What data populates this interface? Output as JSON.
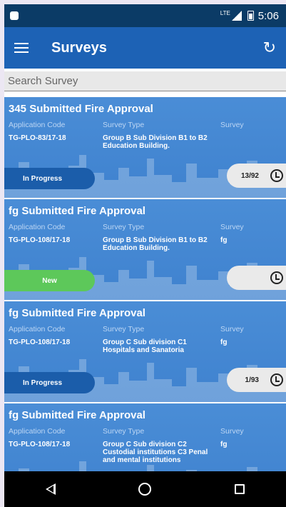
{
  "status_bar": {
    "network": "LTE",
    "time": "5:06"
  },
  "app_bar": {
    "title": "Surveys",
    "menu_icon": "hamburger-icon",
    "refresh_icon": "refresh-icon"
  },
  "search": {
    "placeholder": "Search Survey",
    "value": ""
  },
  "columns": {
    "app_code": "Application Code",
    "survey_type": "Survey Type",
    "survey": "Survey"
  },
  "cards": [
    {
      "title": "345 Submitted Fire Approval",
      "app_code": "TG-PLO-83/17-18",
      "survey_type": "Group B Sub Division B1 to B2 Education Building.",
      "survey": "",
      "status": "In Progress",
      "count": "13/92"
    },
    {
      "title": "fg Submitted Fire Approval",
      "app_code": "TG-PLO-108/17-18",
      "survey_type": "Group B Sub Division B1 to B2 Education Building.",
      "survey": "fg",
      "status": "New",
      "count": ""
    },
    {
      "title": "fg Submitted Fire Approval",
      "app_code": "TG-PLO-108/17-18",
      "survey_type": "Group C Sub division C1 Hospitals and Sanatoria",
      "survey": "fg",
      "status": "In Progress",
      "count": "1/93"
    },
    {
      "title": "fg Submitted Fire Approval",
      "app_code": "TG-PLO-108/17-18",
      "survey_type": "Group C Sub division C2 Custodial institutions C3 Penal and mental institutions",
      "survey": "fg",
      "status": "",
      "count": ""
    }
  ],
  "colors": {
    "status_bar": "#0b3b66",
    "app_bar": "#1d62b5",
    "card_bg": "#4a8dd6",
    "in_progress": "#1b5daa",
    "new": "#5dc85a"
  }
}
